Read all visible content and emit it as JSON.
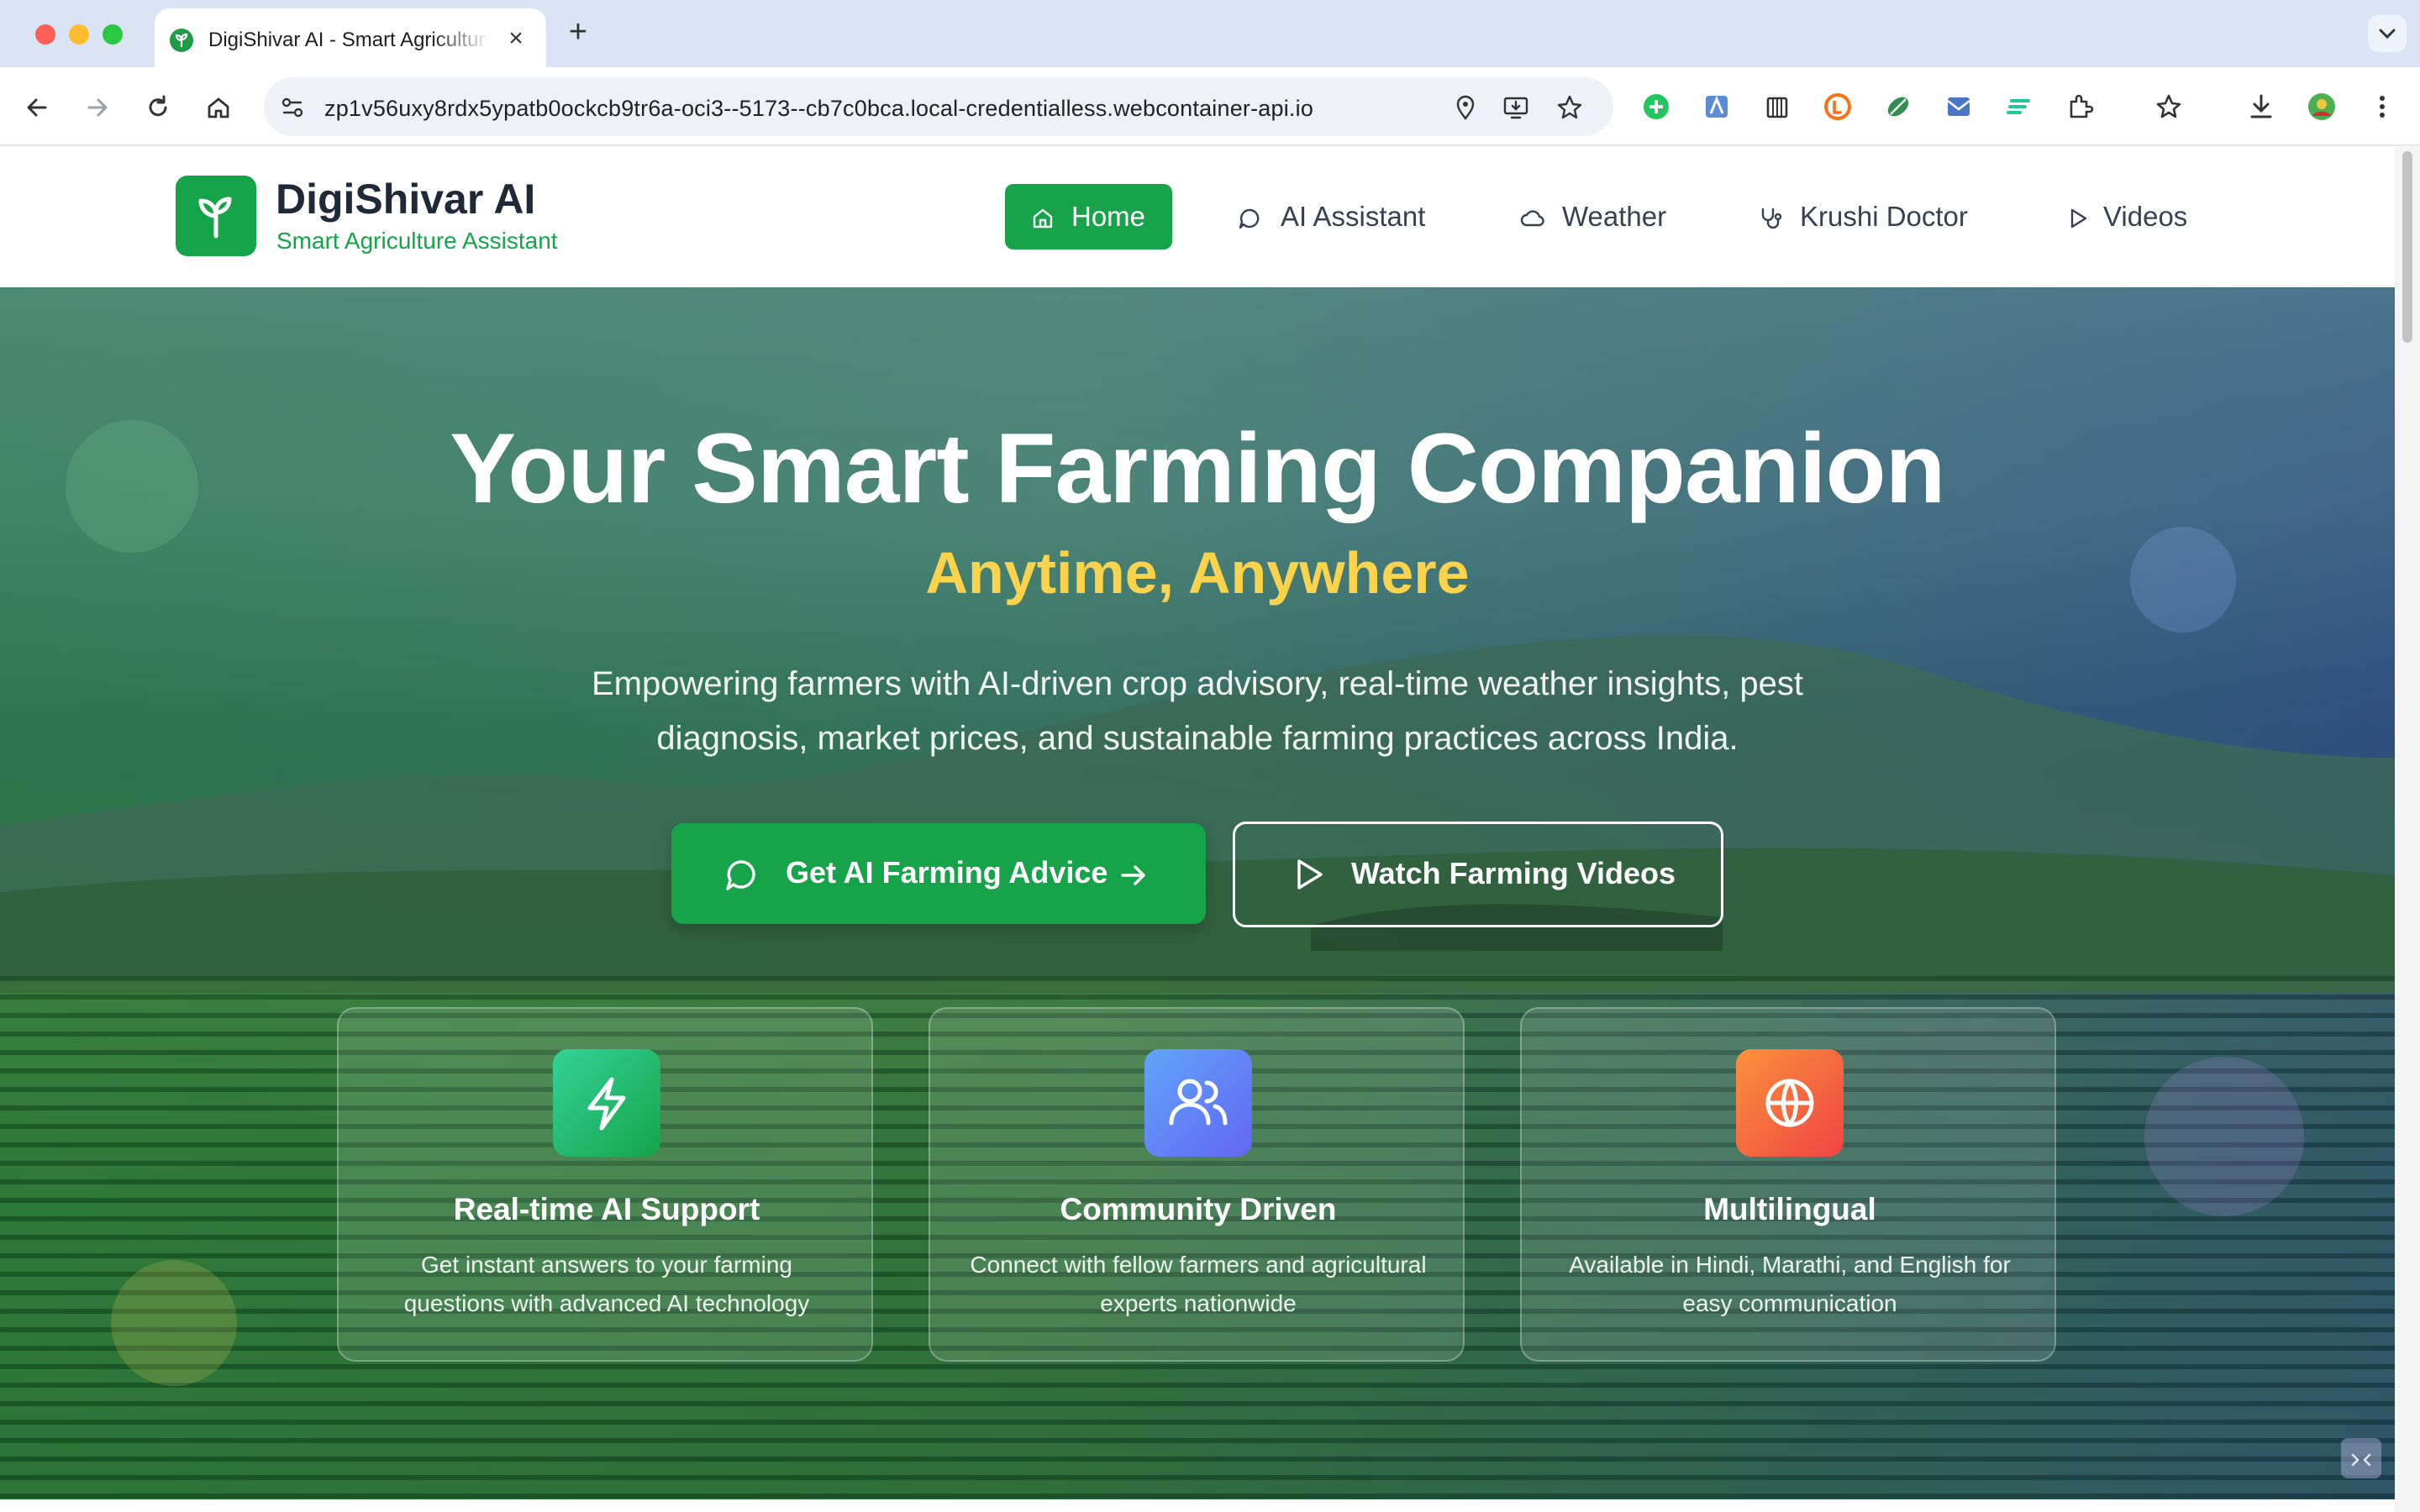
{
  "browser": {
    "tab_title": "DigiShivar AI - Smart Agriculture Assistant",
    "tab_close": "×",
    "new_tab": "+",
    "url": "zp1v56uxy8rdx5ypatb0ockcb9tr6a-oci3--5173--cb7c0bca.local-credentialless.webcontainer-api.io"
  },
  "site": {
    "brand_name": "DigiShivar AI",
    "brand_tagline": "Smart Agriculture Assistant",
    "nav": [
      {
        "label": "Home",
        "icon": "home-icon",
        "active": true
      },
      {
        "label": "AI Assistant",
        "icon": "chat-icon",
        "active": false
      },
      {
        "label": "Weather",
        "icon": "cloud-icon",
        "active": false
      },
      {
        "label": "Krushi Doctor",
        "icon": "stethoscope-icon",
        "active": false
      },
      {
        "label": "Videos",
        "icon": "play-icon",
        "active": false
      }
    ]
  },
  "hero": {
    "title": "Your Smart Farming Companion",
    "subtitle": "Anytime, Anywhere",
    "description": "Empowering farmers with AI-driven crop advisory, real-time weather insights, pest diagnosis, market prices, and sustainable farming practices across India.",
    "primary_button": "Get AI Farming Advice",
    "secondary_button": "Watch Farming Videos"
  },
  "features": [
    {
      "title": "Real-time AI Support",
      "description": "Get instant answers to your farming questions with advanced AI technology",
      "icon": "lightning-icon",
      "color": "#22c55e"
    },
    {
      "title": "Community Driven",
      "description": "Connect with fellow farmers and agricultural experts nationwide",
      "icon": "users-icon",
      "color": "#6366f1"
    },
    {
      "title": "Multilingual",
      "description": "Available in Hindi, Marathi, and English for easy communication",
      "icon": "globe-icon",
      "color": "#f97316"
    }
  ],
  "colors": {
    "brand_green": "#16a34a",
    "accent_yellow": "#fcd34d"
  }
}
